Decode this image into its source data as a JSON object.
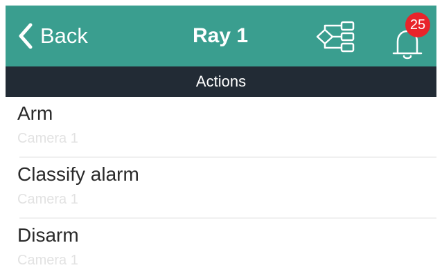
{
  "header": {
    "back_label": "Back",
    "title": "Ray 1",
    "notification_count": "25",
    "bar_color": "#3a9e8f",
    "badge_color": "#e8242a"
  },
  "section": {
    "title": "Actions",
    "bg_color": "#222b35"
  },
  "actions": [
    {
      "title": "Arm",
      "subtitle": "Camera 1"
    },
    {
      "title": "Classify alarm",
      "subtitle": "Camera 1"
    },
    {
      "title": "Disarm",
      "subtitle": "Camera 1"
    }
  ],
  "icons": {
    "back": "chevron-left-icon",
    "tree": "hierarchy-icon",
    "notifications": "bell-icon"
  }
}
